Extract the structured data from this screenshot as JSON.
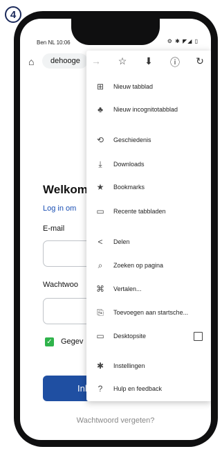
{
  "step": "4",
  "status": {
    "time": "Ben NL 10:06",
    "icons": "⚙ ✱ ◤◢ ▯"
  },
  "url": {
    "text": "dehooge"
  },
  "toolbar": {
    "forward_icon": "→",
    "star_icon": "☆",
    "download_icon": "⬇",
    "info_icon": "ⓘ",
    "reload_icon": "↻"
  },
  "page": {
    "welcome": "Welkom",
    "login_link": "Log in om",
    "email_label": "E-mail",
    "password_label": "Wachtwoo",
    "remember_label": "Gegev",
    "login_button": "Inlo",
    "forgot": "Wachtwoord vergeten?"
  },
  "menu": {
    "items": [
      {
        "label": "Nieuw tabblad",
        "icon": "new-tab-icon"
      },
      {
        "label": "Nieuw incognitotabblad",
        "icon": "incognito-icon"
      },
      {
        "label": "Geschiedenis",
        "icon": "history-icon"
      },
      {
        "label": "Downloads",
        "icon": "downloads-icon"
      },
      {
        "label": "Bookmarks",
        "icon": "star-icon"
      },
      {
        "label": "Recente tabbladen",
        "icon": "recent-tabs-icon"
      },
      {
        "label": "Delen",
        "icon": "share-icon"
      },
      {
        "label": "Zoeken op pagina",
        "icon": "find-in-page-icon"
      },
      {
        "label": "Vertalen...",
        "icon": "translate-icon"
      },
      {
        "label": "Toevoegen aan startsche...",
        "icon": "add-to-home-icon"
      },
      {
        "label": "Desktopsite",
        "icon": "desktop-icon",
        "checked": false
      },
      {
        "label": "Instellingen",
        "icon": "settings-icon"
      },
      {
        "label": "Hulp en feedback",
        "icon": "help-icon"
      }
    ]
  }
}
